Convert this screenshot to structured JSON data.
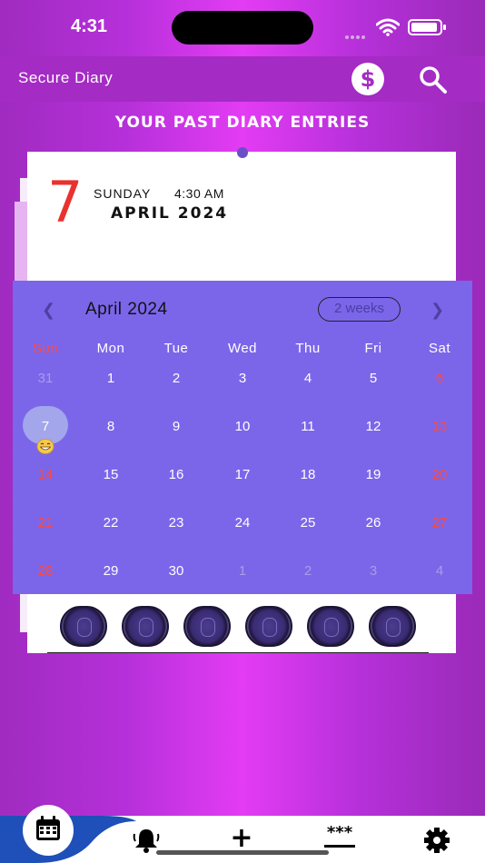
{
  "status_bar": {
    "time": "4:31"
  },
  "app_bar": {
    "title": "Secure Diary",
    "dollar_icon": "dollar-icon",
    "search_icon": "search-icon"
  },
  "section_title": "YOUR PAST DIARY ENTRIES",
  "entry": {
    "day": "7",
    "weekday": "SUNDAY",
    "time": "4:30 AM",
    "month_year": "APRIL  2024"
  },
  "calendar": {
    "title": "April 2024",
    "format_button": "2 weeks",
    "prev_icon": "chevron-left-icon",
    "next_icon": "chevron-right-icon",
    "weekdays": [
      "Sun",
      "Mon",
      "Tue",
      "Wed",
      "Thu",
      "Fri",
      "Sat"
    ],
    "weeks": [
      [
        "31",
        "1",
        "2",
        "3",
        "4",
        "5",
        "6"
      ],
      [
        "7",
        "8",
        "9",
        "10",
        "11",
        "12",
        "13"
      ],
      [
        "14",
        "15",
        "16",
        "17",
        "18",
        "19",
        "20"
      ],
      [
        "21",
        "22",
        "23",
        "24",
        "25",
        "26",
        "27"
      ],
      [
        "28",
        "29",
        "30",
        "1",
        "2",
        "3",
        "4"
      ]
    ],
    "selected_day": "7",
    "marker": "grinning-emoji"
  },
  "photos": {
    "count": 6,
    "icon": "fingerprint-photo"
  },
  "bottom_nav": [
    {
      "icon": "calendar-icon",
      "active": true
    },
    {
      "icon": "bell-icon"
    },
    {
      "icon": "plus-icon",
      "label": "+"
    },
    {
      "icon": "password-icon",
      "label": "***"
    },
    {
      "icon": "gear-icon"
    }
  ],
  "colors": {
    "background_center": "#e33cf4",
    "background_edge": "#a02bc0",
    "calendar_bg": "#7b66ea",
    "weekend": "#ff4a3d",
    "day_number": "#e8322e",
    "nav_accent": "#1f4fb8"
  }
}
